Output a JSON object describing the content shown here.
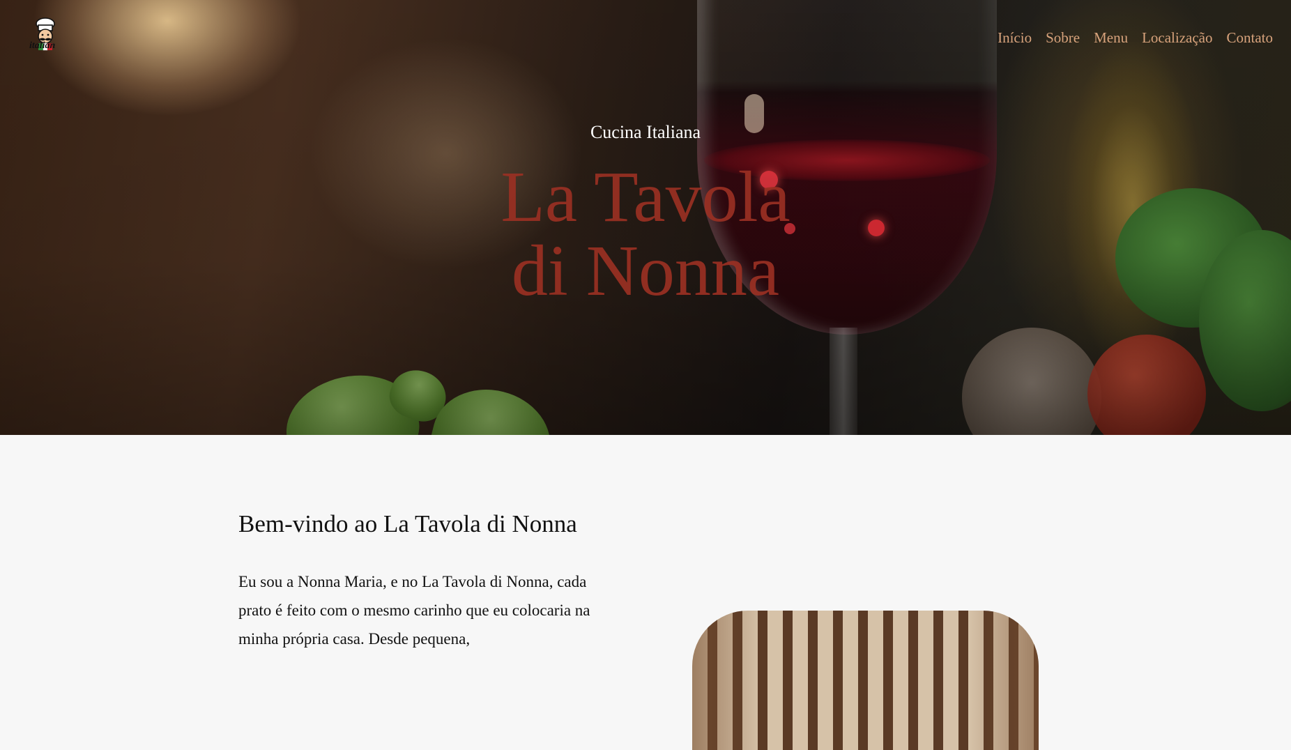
{
  "header": {
    "logo_text": "italian",
    "nav": [
      {
        "label": "Início"
      },
      {
        "label": "Sobre"
      },
      {
        "label": "Menu"
      },
      {
        "label": "Localização"
      },
      {
        "label": "Contato"
      }
    ],
    "nav_color": "#d8a37c"
  },
  "hero": {
    "subtitle": "Cucina Italiana",
    "title_line1": "La Tavola",
    "title_line2": "di Nonna",
    "title_color": "#9a3023"
  },
  "about": {
    "heading": "Bem-vindo ao La Tavola di Nonna",
    "paragraph": "Eu sou a Nonna Maria, e no La Tavola di Nonna, cada prato é feito com o mesmo carinho que eu colocaria na minha própria casa. Desde pequena,"
  }
}
